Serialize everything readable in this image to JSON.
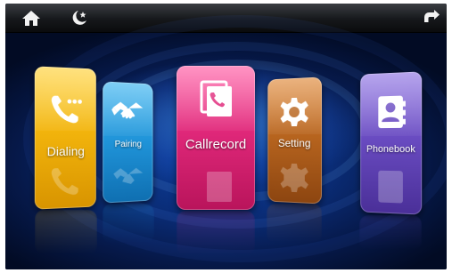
{
  "topbar": {
    "home_icon": "home-icon",
    "night_icon": "moon-star-icon",
    "back_icon": "back-arrow-icon"
  },
  "apps": [
    {
      "label": "Dialing",
      "icon": "phone-icon",
      "color": "#f2b40c"
    },
    {
      "label": "Pairing",
      "icon": "handshake-icon",
      "color": "#1f93d8"
    },
    {
      "label": "Callrecord",
      "icon": "call-record-icon",
      "color": "#e0287a"
    },
    {
      "label": "Setting",
      "icon": "gear-icon",
      "color": "#b8651f"
    },
    {
      "label": "Phonebook",
      "icon": "phonebook-icon",
      "color": "#6a4cc2"
    }
  ]
}
